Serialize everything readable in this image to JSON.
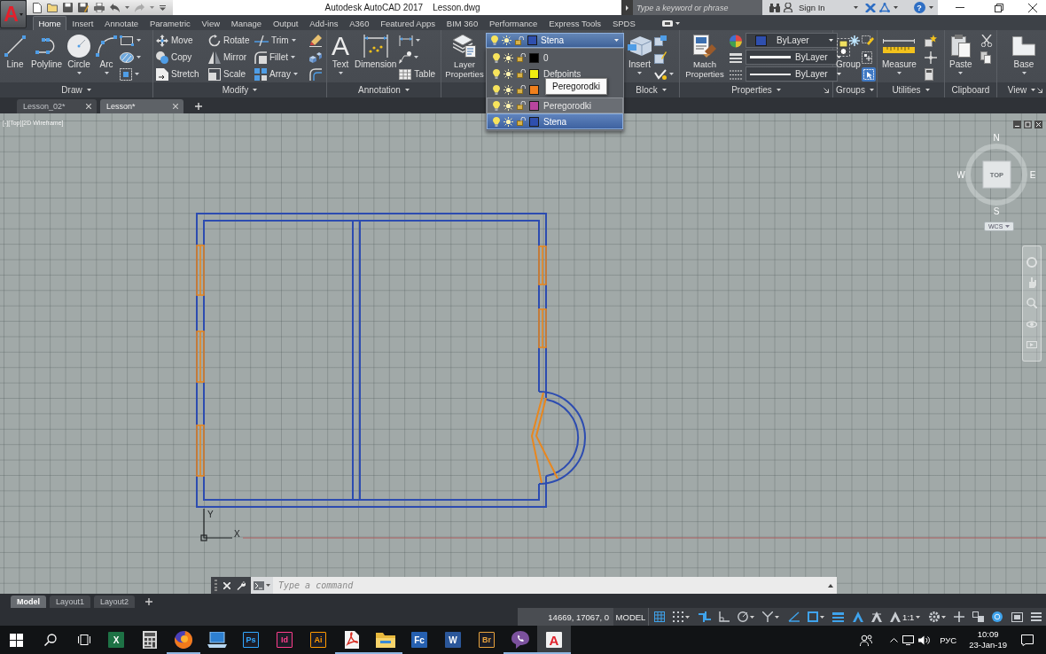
{
  "title_bar": {
    "app_button": "A",
    "title": "Autodesk AutoCAD 2017",
    "document": "Lesson.dwg",
    "search": {
      "placeholder": "Type a keyword or phrase"
    },
    "sign_in": "Sign In",
    "help": "?"
  },
  "ribbon_tabs": [
    {
      "label": "Home",
      "selected": true
    },
    {
      "label": "Insert",
      "selected": false
    },
    {
      "label": "Annotate",
      "selected": false
    },
    {
      "label": "Parametric",
      "selected": false
    },
    {
      "label": "View",
      "selected": false
    },
    {
      "label": "Manage",
      "selected": false
    },
    {
      "label": "Output",
      "selected": false
    },
    {
      "label": "Add-ins",
      "selected": false
    },
    {
      "label": "A360",
      "selected": false
    },
    {
      "label": "Featured Apps",
      "selected": false
    },
    {
      "label": "BIM 360",
      "selected": false
    },
    {
      "label": "Performance",
      "selected": false
    },
    {
      "label": "Express Tools",
      "selected": false
    },
    {
      "label": "SPDS",
      "selected": false
    }
  ],
  "ribbon_panels": [
    {
      "kind": "draw",
      "title": "Draw",
      "expandable": true,
      "launcher": false,
      "tools": [
        {
          "label": "Line",
          "dropdown": false
        },
        {
          "label": "Polyline",
          "dropdown": false
        },
        {
          "label": "Circle",
          "dropdown": true
        },
        {
          "label": "Arc",
          "dropdown": true
        }
      ]
    },
    {
      "kind": "modify",
      "title": "Modify",
      "expandable": true,
      "launcher": false,
      "tools": [
        {
          "label": "Move",
          "dropdown": false
        },
        {
          "label": "Rotate",
          "dropdown": false
        },
        {
          "label": "Trim",
          "dropdown": true
        },
        {
          "label": "Copy",
          "dropdown": false
        },
        {
          "label": "Mirror",
          "dropdown": false
        },
        {
          "label": "Fillet",
          "dropdown": true
        },
        {
          "label": "Stretch",
          "dropdown": false
        },
        {
          "label": "Scale",
          "dropdown": false
        },
        {
          "label": "Array",
          "dropdown": true
        }
      ]
    },
    {
      "kind": "annotation",
      "title": "Annotation",
      "expandable": true,
      "launcher": false,
      "tools": [
        {
          "label": "Text",
          "glyph": "A",
          "dropdown": true
        },
        {
          "label": "Dimension",
          "dropdown": false
        },
        {
          "label": "Table",
          "dropdown": false
        }
      ]
    },
    {
      "kind": "layers",
      "tools": [
        {
          "label": "Layer Properties",
          "dropdown": false
        }
      ],
      "current_layer": {
        "name": "Stena",
        "color": "#2f4fae",
        "on": true,
        "frozen": false,
        "locked": false,
        "expanded": true
      },
      "layer_list": [
        {
          "name": "0",
          "color": "#000000",
          "on": true,
          "frozen": false,
          "locked": false,
          "selected": false,
          "hovered": false
        },
        {
          "name": "Defpoints",
          "color": "#f2ee10",
          "on": true,
          "frozen": false,
          "locked": false,
          "selected": false,
          "hovered": false
        },
        {
          "color": "#f07f1c",
          "on": true,
          "frozen": false,
          "locked": false,
          "selected": false,
          "hovered": false
        },
        {
          "name": "Peregorodki",
          "color": "#b8459e",
          "on": true,
          "frozen": false,
          "locked": false,
          "selected": false,
          "hovered": true
        },
        {
          "name": "Stena",
          "color": "#2f4fae",
          "on": true,
          "frozen": false,
          "locked": false,
          "selected": true,
          "hovered": false
        }
      ],
      "tooltip": "Peregorodki"
    },
    {
      "kind": "block",
      "title": "Block",
      "expandable": true,
      "launcher": false,
      "tools": [
        {
          "label": "Insert",
          "dropdown": true
        }
      ]
    },
    {
      "kind": "properties",
      "title": "Properties",
      "expandable": true,
      "launcher": true,
      "tools": [
        {
          "label": "Match Properties",
          "dropdown": false
        }
      ],
      "combos": [
        {
          "kind": "color",
          "value": "ByLayer",
          "color": "#2f4fae"
        },
        {
          "kind": "lineweight",
          "value": "ByLayer"
        },
        {
          "kind": "linetype",
          "value": "ByLayer"
        }
      ]
    },
    {
      "kind": "groups",
      "title": "Groups",
      "expandable": true,
      "launcher": false,
      "tools": [
        {
          "label": "Group",
          "dropdown": false
        }
      ],
      "selection_toggle": {
        "on": true
      }
    },
    {
      "kind": "utilities",
      "title": "Utilities",
      "expandable": true,
      "launcher": false,
      "tools": [
        {
          "label": "Measure",
          "dropdown": true
        }
      ]
    },
    {
      "kind": "clipboard",
      "title": "Clipboard",
      "expandable": false,
      "launcher": false,
      "tools": [
        {
          "label": "Paste",
          "dropdown": true
        }
      ]
    },
    {
      "kind": "view",
      "title": "View",
      "expandable": true,
      "launcher": true,
      "tools": [
        {
          "label": "Base",
          "dropdown": true
        }
      ]
    }
  ],
  "file_tabs": [
    {
      "label": "Lesson_02*",
      "selected": false
    },
    {
      "label": "Lesson*",
      "selected": true
    }
  ],
  "viewport": {
    "controls": [
      "[-]",
      "[Top]",
      "[2D Wireframe]"
    ],
    "viewcube": {
      "north": "N",
      "south": "S",
      "east": "E",
      "west": "W",
      "face": "TOP",
      "ucs_menu": "WCS"
    },
    "ucs": {
      "x": "X",
      "y": "Y"
    },
    "command_line": {
      "placeholder": "Type a command"
    }
  },
  "layout_tabs": [
    {
      "label": "Model",
      "selected": true
    },
    {
      "label": "Layout1",
      "selected": false
    },
    {
      "label": "Layout2",
      "selected": false
    }
  ],
  "status_bar": {
    "coordinates": "14669, 17067, 0",
    "space": "MODEL",
    "items": [
      {
        "kind": "grid",
        "on": true,
        "dropdown": false
      },
      {
        "kind": "snap",
        "on": false,
        "dropdown": true
      },
      {
        "kind": "infer",
        "on": true,
        "dropdown": false
      },
      {
        "kind": "ortho",
        "on": false,
        "dropdown": false
      },
      {
        "kind": "polar",
        "on": false,
        "dropdown": true
      },
      {
        "kind": "isometric",
        "on": false,
        "dropdown": true
      },
      {
        "kind": "tracking",
        "on": true,
        "dropdown": false
      },
      {
        "kind": "osnap",
        "on": true,
        "dropdown": true
      },
      {
        "kind": "lineweight",
        "on": true,
        "dropdown": false
      },
      {
        "kind": "annotation_visibility",
        "on": true,
        "dropdown": false
      },
      {
        "kind": "autoscale",
        "on": false,
        "dropdown": false
      },
      {
        "kind": "annotation_scale",
        "label": "1:1",
        "dropdown": true
      },
      {
        "kind": "workspace",
        "on": false,
        "dropdown": true
      },
      {
        "kind": "annotation_monitor",
        "on": false,
        "dropdown": false
      },
      {
        "kind": "isolate",
        "on": false,
        "dropdown": false
      },
      {
        "kind": "performance",
        "on": true,
        "dropdown": false
      },
      {
        "kind": "clean_screen",
        "on": false,
        "dropdown": false
      },
      {
        "kind": "customize",
        "on": false,
        "dropdown": false
      }
    ]
  },
  "taskbar": {
    "apps": [
      {
        "kind": "tile",
        "label": "X",
        "color": "#1e7245",
        "running": false,
        "selected": false
      },
      {
        "kind": "calculator",
        "running": false,
        "selected": false
      },
      {
        "kind": "browser",
        "running": true,
        "selected": false
      },
      {
        "kind": "laptop",
        "running": false,
        "selected": false
      },
      {
        "kind": "outlined",
        "label": "Ps",
        "color": "#31a8ff",
        "running": false,
        "selected": false
      },
      {
        "kind": "outlined",
        "label": "Id",
        "color": "#ff3d8b",
        "running": false,
        "selected": false
      },
      {
        "kind": "outlined",
        "label": "Ai",
        "color": "#ff9a00",
        "running": false,
        "selected": false
      },
      {
        "kind": "document",
        "running": true,
        "selected": false
      },
      {
        "kind": "folder",
        "running": true,
        "selected": false
      },
      {
        "kind": "tile",
        "label": "Fc",
        "color": "#2660b0",
        "running": false,
        "selected": false
      },
      {
        "kind": "tile",
        "label": "W",
        "color": "#2b579a",
        "running": false,
        "selected": false
      },
      {
        "kind": "outlined",
        "label": "Br",
        "color": "#e8a33c",
        "running": false,
        "selected": false
      },
      {
        "kind": "chat",
        "running": true,
        "selected": false
      },
      {
        "kind": "cad",
        "label": "A",
        "color": "#e0202a",
        "running": true,
        "selected": true
      }
    ],
    "tray": {
      "language": "РУС",
      "time": "10:09",
      "date": "23-Jan-19"
    }
  }
}
